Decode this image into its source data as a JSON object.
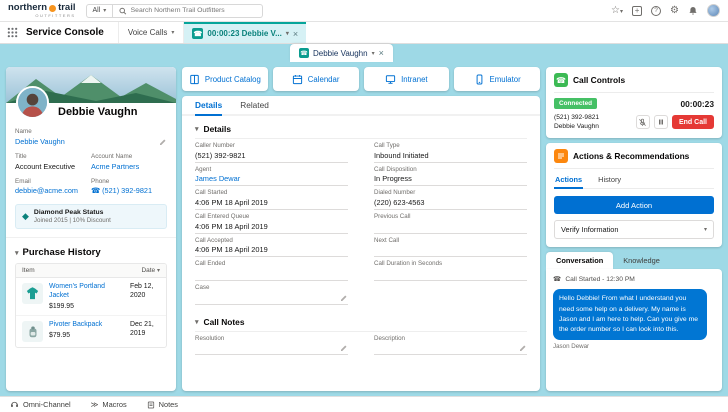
{
  "header": {
    "logo_word1": "northern",
    "logo_word2": "trail",
    "logo_tagline": "OUTFITTERS",
    "search_scope": "All",
    "search_placeholder": "Search Northern Trail Outfitters"
  },
  "nav": {
    "app": "Service Console",
    "menu_tab": "Voice Calls",
    "call_tab": "00:00:23 Debbie V...",
    "subtab": "Debbie Vaughn"
  },
  "contact": {
    "display_name": "Debbie Vaughn",
    "name_label": "Name",
    "name_value": "Debbie Vaughn",
    "title_label": "Title",
    "title_value": "Account Executive",
    "account_label": "Account Name",
    "account_value": "Acme Partners",
    "email_label": "Email",
    "email_value": "debbie@acme.com",
    "phone_label": "Phone",
    "phone_value": "(521) 392-9821",
    "status_title": "Diamond Peak Status",
    "status_detail": "Joined 2015   |   10% Discount",
    "purchase_title": "Purchase History",
    "purchase_col_item": "Item",
    "purchase_col_date": "Date",
    "purchase_rows": [
      {
        "name": "Women's Portland Jacket",
        "price": "$199.95",
        "date": "Feb 12, 2020"
      },
      {
        "name": "Pivoter Backpack",
        "price": "$79.95",
        "date": "Dec 21, 2019"
      }
    ]
  },
  "quick_actions": [
    {
      "label": "Product Catalog"
    },
    {
      "label": "Calendar"
    },
    {
      "label": "Intranet"
    },
    {
      "label": "Emulator"
    }
  ],
  "record": {
    "tab_details": "Details",
    "tab_related": "Related",
    "section_details": "Details",
    "section_notes": "Call Notes",
    "fields": [
      {
        "label": "Caller Number",
        "value": "(521) 392-9821"
      },
      {
        "label": "Call Type",
        "value": "Inbound Initiated"
      },
      {
        "label": "Agent",
        "value": "James Dewar"
      },
      {
        "label": "Call Disposition",
        "value": "In Progress"
      },
      {
        "label": "Call Started",
        "value": "4:06 PM 18 April 2019"
      },
      {
        "label": "Dialed Number",
        "value": "(220) 623-4563"
      },
      {
        "label": "Call Entered Queue",
        "value": "4:06 PM 18 April 2019"
      },
      {
        "label": "Previous Call",
        "value": ""
      },
      {
        "label": "Call Accepted",
        "value": "4:06 PM 18 April 2019"
      },
      {
        "label": "Next Call",
        "value": ""
      },
      {
        "label": "Call Ended",
        "value": ""
      },
      {
        "label": "Call Duration in Seconds",
        "value": ""
      },
      {
        "label": "Case",
        "value": ""
      }
    ],
    "notes_fields": [
      {
        "label": "Resolution"
      },
      {
        "label": "Description"
      }
    ]
  },
  "call_controls": {
    "title": "Call Controls",
    "status_badge": "Connected",
    "timer": "00:00:23",
    "caller_number": "(521) 392-9821",
    "caller_name": "Debbie Vaughn",
    "end_call_label": "End Call"
  },
  "actions_panel": {
    "title": "Actions & Recommendations",
    "tab_actions": "Actions",
    "tab_history": "History",
    "add_action_label": "Add Action",
    "selected_action": "Verify Information"
  },
  "conversation": {
    "tab_conversation": "Conversation",
    "tab_knowledge": "Knowledge",
    "call_started": "Call Started - 12:30 PM",
    "message": "Hello Debbie! From what I understand you need some help on a delivery. My name is Jason and I am here to help. Can you give me the order number so I can look into this.",
    "sender": "Jason Dewar"
  },
  "footer": {
    "omni": "Omni-Channel",
    "macros": "Macros",
    "notes": "Notes"
  },
  "colors": {
    "brand_blue": "#0070d2",
    "teal": "#0b827c",
    "green": "#3cba54",
    "red": "#e53935",
    "orange": "#fc870e",
    "background": "#9ed9e6",
    "bubble_blue": "#0176d3"
  }
}
